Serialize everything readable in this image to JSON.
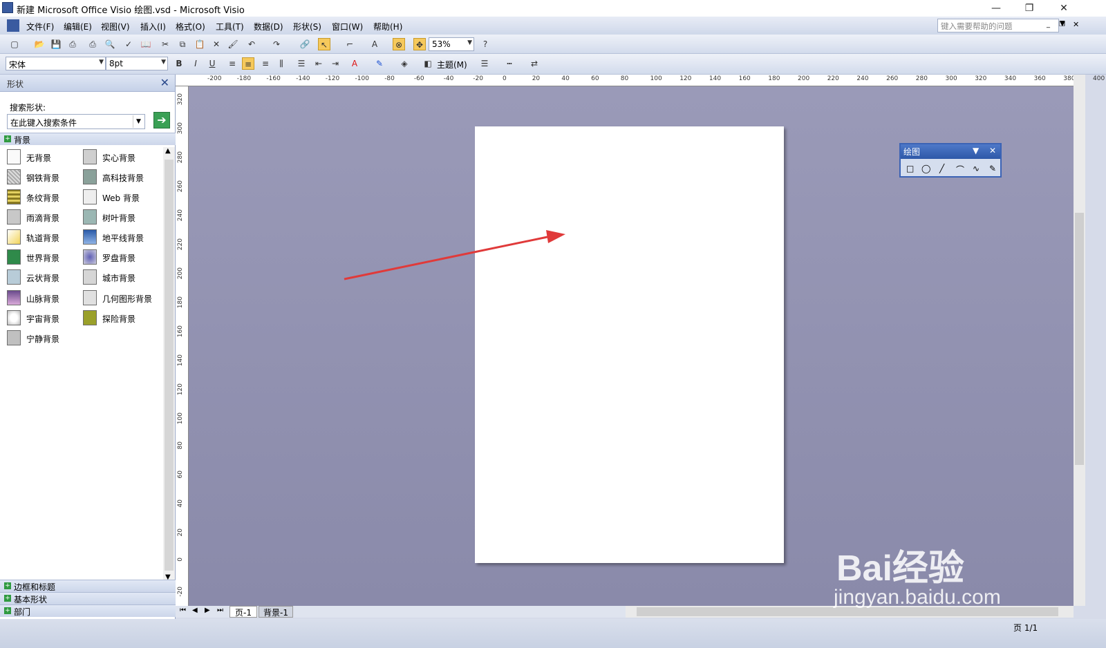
{
  "window": {
    "title": "新建 Microsoft Office Visio 绘图.vsd - Microsoft Visio"
  },
  "menubar": {
    "items": [
      "文件(F)",
      "编辑(E)",
      "视图(V)",
      "插入(I)",
      "格式(O)",
      "工具(T)",
      "数据(D)",
      "形状(S)",
      "窗口(W)",
      "帮助(H)"
    ],
    "help_placeholder": "键入需要帮助的问题"
  },
  "toolbar": {
    "zoom": "53%"
  },
  "format_toolbar": {
    "font": "宋体",
    "size": "8pt",
    "theme_label": "主题(M)"
  },
  "shapes_pane": {
    "title": "形状",
    "search_label": "搜索形状:",
    "search_placeholder": "在此键入搜索条件",
    "category_open": "背景",
    "stencil_items": [
      "无背景",
      "实心背景",
      "钢铁背景",
      "高科技背景",
      "条纹背景",
      "Web 背景",
      "雨滴背景",
      "树叶背景",
      "轨道背景",
      "地平线背景",
      "世界背景",
      "罗盘背景",
      "云状背景",
      "城市背景",
      "山脉背景",
      "几何图形背景",
      "宇宙背景",
      "探险背景",
      "宁静背景"
    ],
    "categories_closed": [
      "边框和标题",
      "基本形状",
      "部门"
    ]
  },
  "ruler_h": [
    "-200",
    "-180",
    "-160",
    "-140",
    "-120",
    "-100",
    "-80",
    "-60",
    "-40",
    "-20",
    "0",
    "20",
    "40",
    "60",
    "80",
    "100",
    "120",
    "140",
    "160",
    "180",
    "200",
    "220",
    "240",
    "260",
    "280",
    "300",
    "320",
    "340",
    "360",
    "380",
    "400"
  ],
  "ruler_v": [
    "320",
    "300",
    "280",
    "260",
    "240",
    "220",
    "200",
    "180",
    "160",
    "140",
    "120",
    "100",
    "80",
    "60",
    "40",
    "20",
    "0",
    "-20"
  ],
  "drawing_toolbar": {
    "title": "绘图"
  },
  "page_tabs": [
    "页-1",
    "背景-1"
  ],
  "status": {
    "page": "页 1/1"
  },
  "watermark": {
    "brand": "Bai经验",
    "url": "jingyan.baidu.com"
  },
  "colors": {
    "canvas": "#9090b0",
    "page": "#ffffff",
    "arrow": "#e03a3a",
    "accent": "#3b63b5"
  }
}
